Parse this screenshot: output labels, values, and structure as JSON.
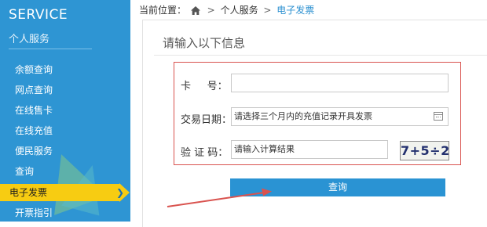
{
  "sidebar": {
    "title": "SERVICE",
    "subtitle": "个人服务",
    "items": [
      {
        "label": "余额查询",
        "active": false
      },
      {
        "label": "网点查询",
        "active": false
      },
      {
        "label": "在线售卡",
        "active": false
      },
      {
        "label": "在线充值",
        "active": false
      },
      {
        "label": "便民服务",
        "active": false
      },
      {
        "label": "查询",
        "active": false
      },
      {
        "label": "电子发票",
        "active": true
      },
      {
        "label": "开票指引",
        "active": false
      }
    ],
    "colors": {
      "background": "#2e95d3",
      "active": "#f7cc12"
    }
  },
  "breadcrumb": {
    "prefix": "当前位置：",
    "home_icon": "home-icon",
    "separator": ">",
    "level1": "个人服务",
    "current": "电子发票"
  },
  "form": {
    "title": "请输入以下信息",
    "card_label": "卡     号：",
    "card_value": "",
    "date_label": "交易日期：",
    "date_placeholder": "请选择三个月内的充值记录开具发票",
    "date_icon": "calendar-icon",
    "code_label": "验 证 码：",
    "code_placeholder": "请输入计算结果",
    "captcha_text": "7+5÷2",
    "submit_label": "查询",
    "highlight_color": "#d9534f",
    "button_color": "#2a93d3"
  }
}
